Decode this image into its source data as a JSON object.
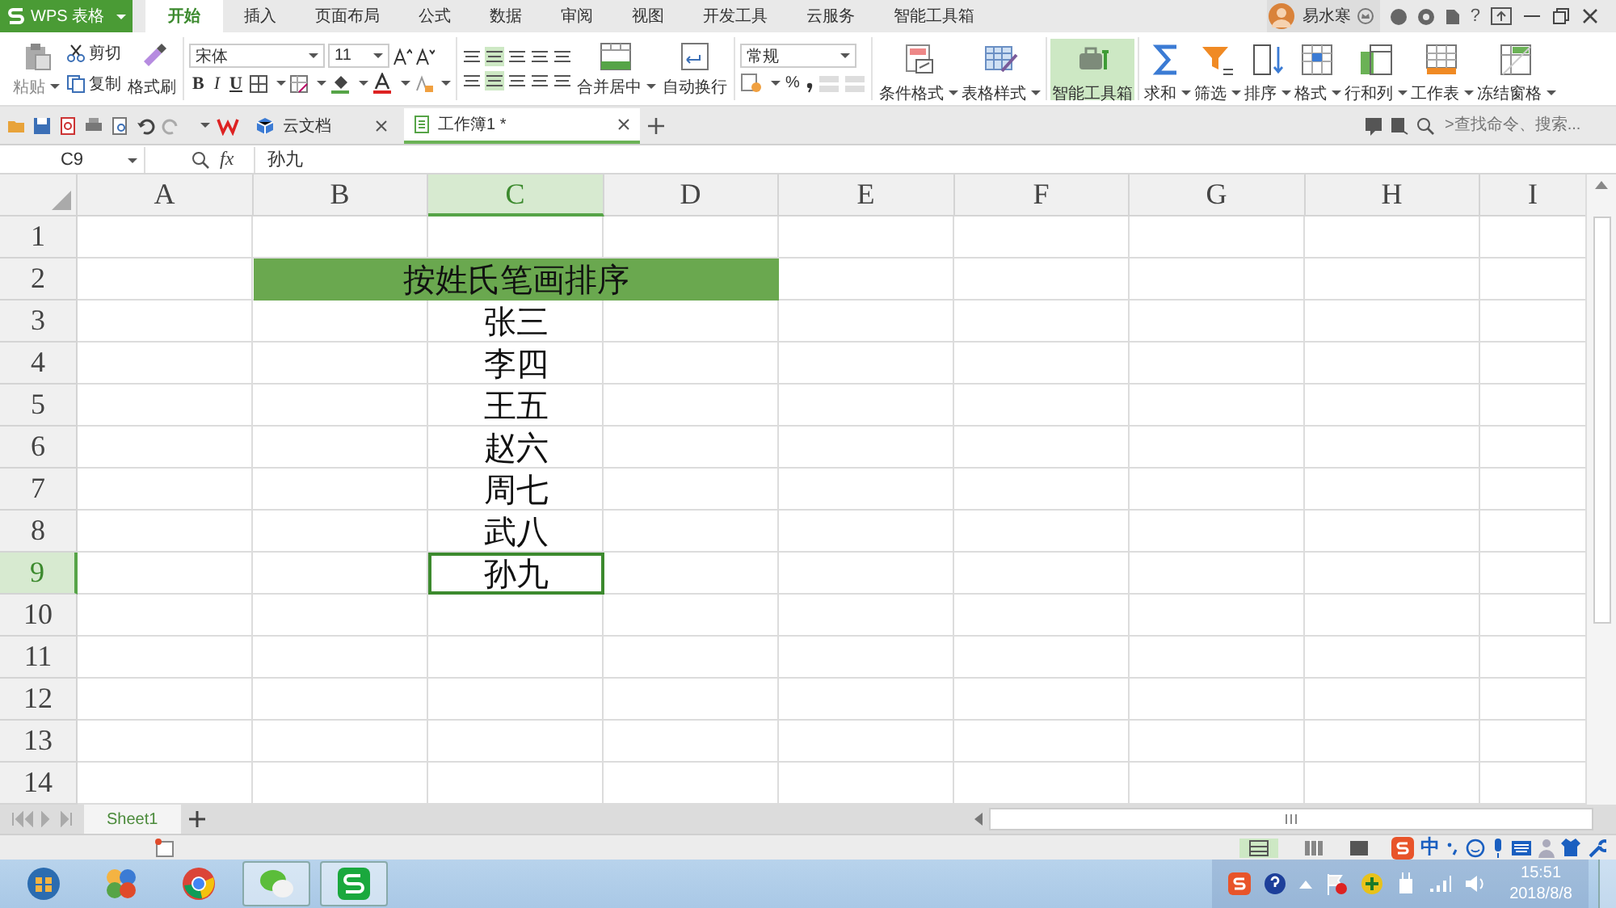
{
  "app_button": {
    "label": "WPS 表格"
  },
  "menu_tabs": [
    {
      "label": "开始",
      "selected": true
    },
    {
      "label": "插入",
      "selected": false
    },
    {
      "label": "页面布局",
      "selected": false
    },
    {
      "label": "公式",
      "selected": false
    },
    {
      "label": "数据",
      "selected": false
    },
    {
      "label": "审阅",
      "selected": false
    },
    {
      "label": "视图",
      "selected": false
    },
    {
      "label": "开发工具",
      "selected": false
    },
    {
      "label": "云服务",
      "selected": false
    },
    {
      "label": "智能工具箱",
      "selected": false
    }
  ],
  "user": {
    "name": "易水寒"
  },
  "help": "?",
  "ribbon": {
    "clipboard": {
      "paste": "粘贴",
      "cut": "剪切",
      "copy": "复制",
      "format_painter": "格式刷"
    },
    "font": {
      "name": "宋体",
      "size": "11",
      "styles": [
        "B",
        "I",
        "U"
      ]
    },
    "alignment": {
      "merge": "合并居中",
      "wrap": "自动换行"
    },
    "number": {
      "format": "常规",
      "percent": "%"
    },
    "tools": [
      {
        "label": "条件格式",
        "kind": "dropdown",
        "selected": false
      },
      {
        "label": "表格样式",
        "kind": "dropdown",
        "selected": false
      },
      {
        "label": "智能工具箱",
        "kind": "plain",
        "selected": true
      },
      {
        "label": "求和",
        "kind": "dropdown",
        "selected": false
      },
      {
        "label": "筛选",
        "kind": "dropdown",
        "selected": false
      },
      {
        "label": "排序",
        "kind": "dropdown",
        "selected": false
      },
      {
        "label": "格式",
        "kind": "dropdown",
        "selected": false
      },
      {
        "label": "行和列",
        "kind": "dropdown",
        "selected": false
      },
      {
        "label": "工作表",
        "kind": "dropdown",
        "selected": false
      },
      {
        "label": "冻结窗格",
        "kind": "dropdown",
        "selected": false
      }
    ]
  },
  "doc_tabs": [
    {
      "label": "云文档",
      "selected": false
    },
    {
      "label": "工作簿1 *",
      "selected": true
    }
  ],
  "search": {
    "placeholder": ">查找命令、搜索..."
  },
  "formula_bar": {
    "name_box": "C9",
    "fx": "fx",
    "value": "孙九"
  },
  "sheet": {
    "columns": [
      {
        "label": "A",
        "selected": false
      },
      {
        "label": "B",
        "selected": false
      },
      {
        "label": "C",
        "selected": true
      },
      {
        "label": "D",
        "selected": false
      },
      {
        "label": "E",
        "selected": false
      },
      {
        "label": "F",
        "selected": false
      },
      {
        "label": "G",
        "selected": false
      },
      {
        "label": "H",
        "selected": false
      },
      {
        "label": "I",
        "selected": false
      }
    ],
    "rows": [
      {
        "label": "1",
        "selected": false
      },
      {
        "label": "2",
        "selected": false,
        "merged_title": "按姓氏笔画排序"
      },
      {
        "label": "3",
        "selected": false,
        "column_c": "张三"
      },
      {
        "label": "4",
        "selected": false,
        "column_c": "李四"
      },
      {
        "label": "5",
        "selected": false,
        "column_c": "王五"
      },
      {
        "label": "6",
        "selected": false,
        "column_c": "赵六"
      },
      {
        "label": "7",
        "selected": false,
        "column_c": "周七"
      },
      {
        "label": "8",
        "selected": false,
        "column_c": "武八"
      },
      {
        "label": "9",
        "selected": true,
        "column_c": "孙九"
      },
      {
        "label": "10",
        "selected": false
      },
      {
        "label": "11",
        "selected": false
      },
      {
        "label": "12",
        "selected": false
      },
      {
        "label": "13",
        "selected": false
      },
      {
        "label": "14",
        "selected": false
      }
    ]
  },
  "sheet_tabs": [
    {
      "label": "Sheet1",
      "selected": true
    }
  ],
  "ime": {
    "mode": "中"
  },
  "taskbar": {
    "time": "15:51",
    "date": "2018/8/8"
  }
}
